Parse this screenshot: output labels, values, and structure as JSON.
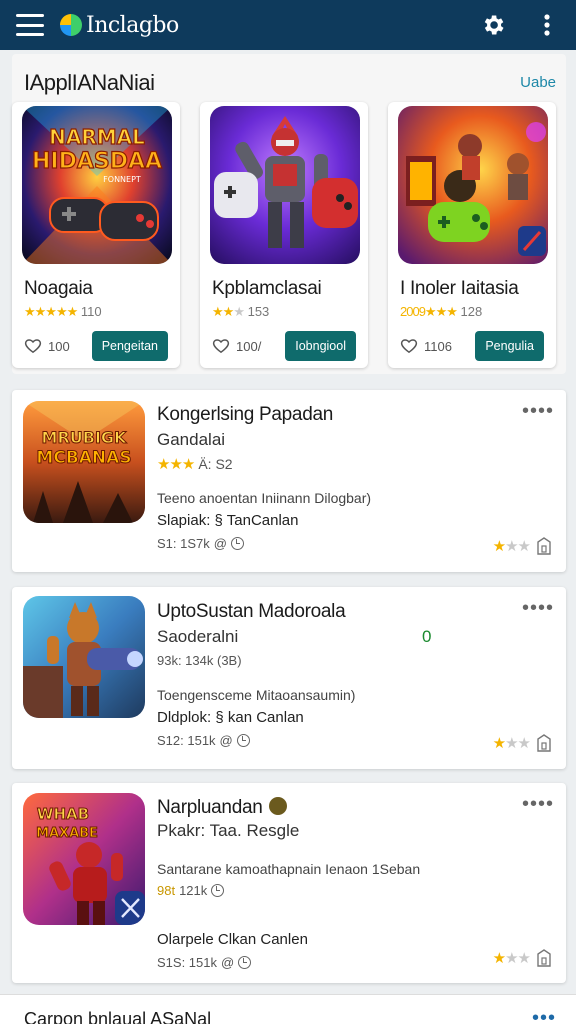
{
  "appbar": {
    "logo_text": "Inclagbo",
    "icons": [
      "menu-icon",
      "gear-icon",
      "more-vertical-icon"
    ]
  },
  "featured": {
    "title": "IApplIANaNiai",
    "see_all": "Uabe",
    "cards": [
      {
        "art_text_1": "NARMAL",
        "art_text_2": "HIDASDAA",
        "art_text_3": "FONNEPT",
        "name": "Noagaia",
        "stars": "★★★★★",
        "stars_off": "",
        "rating": "110",
        "likes": "100",
        "button": "Pengeitan"
      },
      {
        "name": "Kpblamclasai",
        "stars": "★★",
        "stars_off": "★",
        "rating": "153",
        "likes": "100/",
        "button": "Iobngiool"
      },
      {
        "name": "I Inoler Iaitasia",
        "stars": "2009★★★",
        "stars_off": "",
        "rating": "128",
        "likes": "1106",
        "button": "Pengulia"
      }
    ]
  },
  "list": [
    {
      "art_text_1": "MRUBIGK",
      "art_text_2": "MCBANAS",
      "title": "Kongerlsing Papadan",
      "subtitle": "Gandalai",
      "stars": "★★★",
      "rating": "Ä: S2",
      "description": "Teeno anoentan Iniinann Dilogbar)",
      "developer": "Slapiak: § TanCanlan",
      "meta": "S1: 1S7k",
      "meta_icon": "@",
      "rating_stars": "★",
      "rating_stars_off": "★★"
    },
    {
      "title": "UptoSustan Madoroala",
      "subtitle": "Saoderalni",
      "green_mark": "0",
      "rating": "93k: 134k (3B)",
      "description": "Toengensceme Mitaoansaumin)",
      "developer": "Dldplok: § kan Canlan",
      "meta": "S12: 151k",
      "meta_icon": "@",
      "rating_stars": "★",
      "rating_stars_off": "★★"
    },
    {
      "art_text_1": "WHAB",
      "art_text_2": "MAXABE",
      "title": "Narpluandan",
      "subtitle": "Pkakr: Taa. Resgle",
      "rating_gold": "98t",
      "rating": "121k",
      "description": "Santarane kamoathapnain Ienaon 1Seban",
      "developer": "Olarpele Clkan Canlen",
      "meta": "S1S: 151k",
      "meta_icon": "@",
      "rating_stars": "★",
      "rating_stars_off": "★★"
    }
  ],
  "bottom": {
    "text": "Carpon       bnlaual ASaNal"
  },
  "colors": {
    "appbar": "#0e3a5c",
    "accent_button": "#0f6b6c",
    "link": "#1e88a8",
    "star": "#f4b400"
  }
}
